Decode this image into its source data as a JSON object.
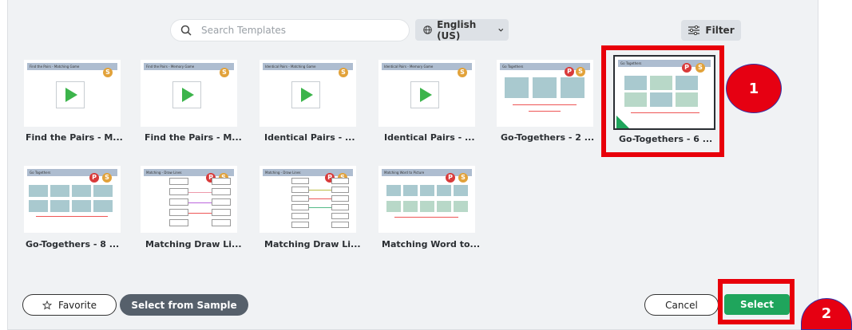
{
  "search": {
    "placeholder": "Search Templates"
  },
  "language": {
    "selected": "English (US)"
  },
  "filter": {
    "label": "Filter"
  },
  "templates": [
    {
      "title": "Find the Pairs - M...",
      "header": "Find the Pairs - Matching Game"
    },
    {
      "title": "Find the Pairs - M...",
      "header": "Find the Pairs - Memory Game"
    },
    {
      "title": "Identical Pairs - ...",
      "header": "Identical Pairs - Matching Game"
    },
    {
      "title": "Identical Pairs - ...",
      "header": "Identical Pairs - Memory Game"
    },
    {
      "title": "Go-Togethers - 2 ...",
      "header": "Go Togethers"
    },
    {
      "title": "Go-Togethers - 6 ...",
      "header": "Go Togethers"
    },
    {
      "title": "Go-Togethers - 8 ...",
      "header": "Go Togethers"
    },
    {
      "title": "Matching Draw Li...",
      "header": "Matching - Draw Lines"
    },
    {
      "title": "Matching Draw Li...",
      "header": "Matching - Draw Lines"
    },
    {
      "title": "Matching Word to...",
      "header": "Matching Word to Picture"
    }
  ],
  "medals": {
    "s": "S",
    "p": "P"
  },
  "annotations": {
    "one": "1",
    "two": "2"
  },
  "footer": {
    "favorite": "Favorite",
    "select_from_sample": "Select from Sample",
    "cancel": "Cancel",
    "select": "Select"
  },
  "colors": {
    "select_green": "#1fa55c",
    "highlight_red": "#e8000a",
    "dark_button": "#56606b"
  }
}
